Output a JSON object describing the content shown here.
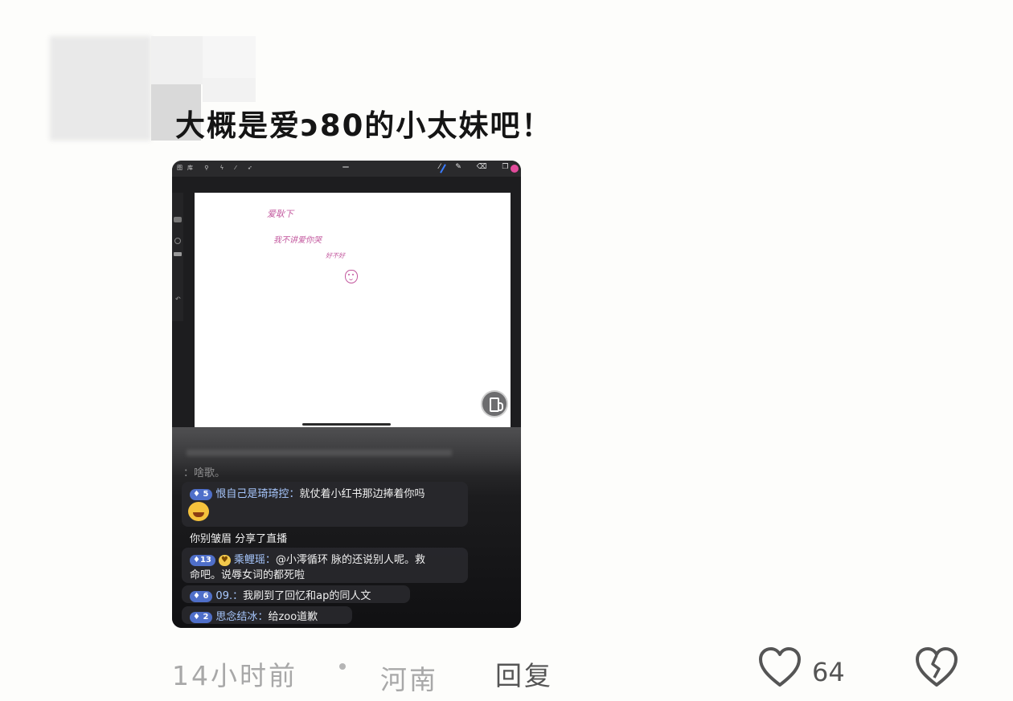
{
  "comment": {
    "text": "大概是爱ↄ80的小太妹吧！",
    "time": "14小时前",
    "separator": "•",
    "location": "河南",
    "reply_label": "回复",
    "like_count": "64"
  },
  "screenshot": {
    "toolbar_left": "图库 ⚲ ϟ ⁄ ➶",
    "toolbar_right": "⁄ ✎ ⌫ ❐",
    "handwriting": {
      "line1": "爱耿下",
      "line2": "我不讲爱你哭",
      "line3": "好不好"
    },
    "chat": {
      "faded_line": "：啥歌。",
      "messages": [
        {
          "level": "5",
          "user": "恨自己是琦琦控",
          "text": "就仗着小红书那边捧着你吗"
        },
        {
          "system": "你别皱眉 分享了直播"
        },
        {
          "level": "13",
          "user": "乘鲤瑶",
          "text": "@小澪循环 脉的还说别人呢。救",
          "text2": "命吧。说辱女词的都死啦"
        },
        {
          "level": "6",
          "user": "09.",
          "text": "我刷到了回忆和ap的同人文"
        },
        {
          "level": "2",
          "user": "思念结冰",
          "text": "给zoo道歉"
        }
      ]
    }
  },
  "colors": {
    "accent_level": "#4f6fc9",
    "handwriting": "#c2569d",
    "background": "#fdfdfb"
  }
}
